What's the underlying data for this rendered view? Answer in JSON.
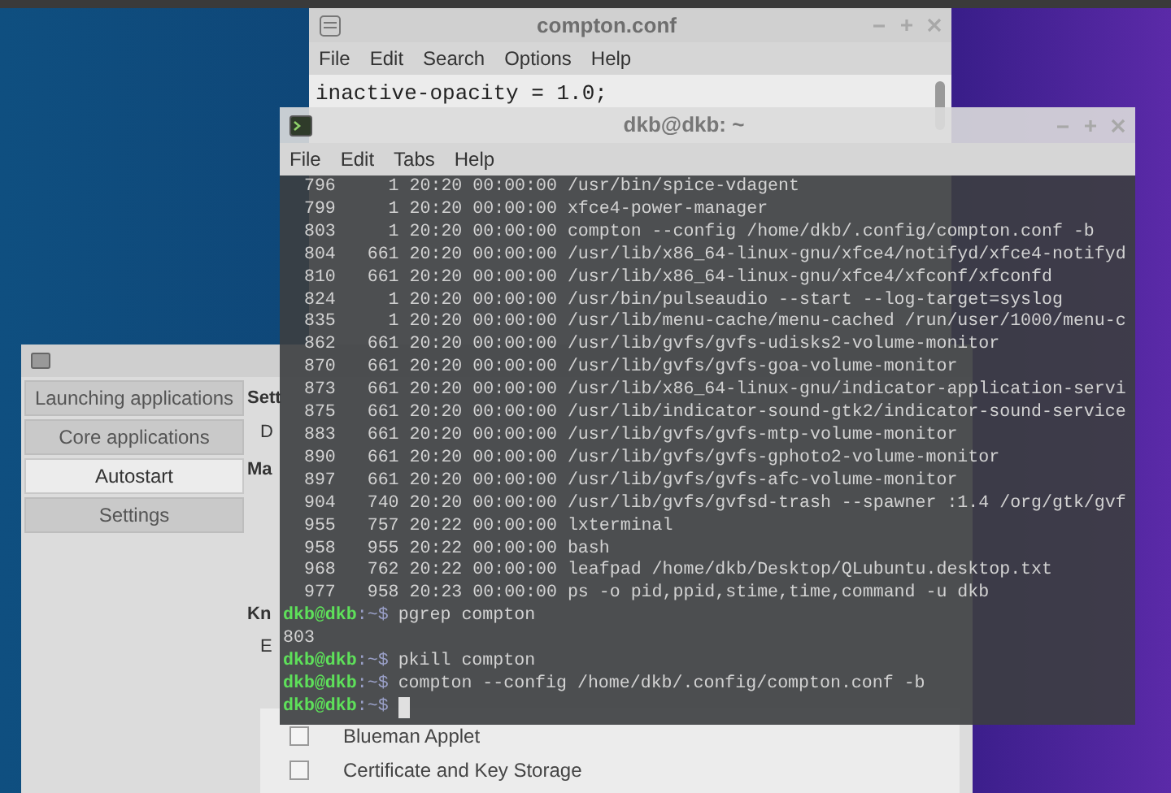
{
  "editor_window": {
    "title": "compton.conf",
    "menu": [
      "File",
      "Edit",
      "Search",
      "Options",
      "Help"
    ],
    "lines": [
      "inactive-opacity = 1.0;"
    ]
  },
  "session_window": {
    "tabs": [
      {
        "label": "Launching applications",
        "selected": false
      },
      {
        "label": "Core applications",
        "selected": false
      },
      {
        "label": "Autostart",
        "selected": true
      },
      {
        "label": "Settings",
        "selected": false
      }
    ],
    "cut_labels": [
      "Sett",
      "D",
      "Ma",
      "Kn",
      "E"
    ],
    "autostart_items": [
      {
        "label": "Blueman Applet",
        "checked": false
      },
      {
        "label": "Certificate and Key Storage",
        "checked": false
      }
    ]
  },
  "terminal_window": {
    "title": "dkb@dkb: ~",
    "menu": [
      "File",
      "Edit",
      "Tabs",
      "Help"
    ],
    "lines": [
      {
        "kind": "output",
        "text": "  796     1 20:20 00:00:00 /usr/bin/spice-vdagent"
      },
      {
        "kind": "output",
        "text": "  799     1 20:20 00:00:00 xfce4-power-manager"
      },
      {
        "kind": "output",
        "text": "  803     1 20:20 00:00:00 compton --config /home/dkb/.config/compton.conf -b"
      },
      {
        "kind": "output",
        "text": "  804   661 20:20 00:00:00 /usr/lib/x86_64-linux-gnu/xfce4/notifyd/xfce4-notifyd"
      },
      {
        "kind": "output",
        "text": "  810   661 20:20 00:00:00 /usr/lib/x86_64-linux-gnu/xfce4/xfconf/xfconfd"
      },
      {
        "kind": "output",
        "text": "  824     1 20:20 00:00:00 /usr/bin/pulseaudio --start --log-target=syslog"
      },
      {
        "kind": "output",
        "text": "  835     1 20:20 00:00:00 /usr/lib/menu-cache/menu-cached /run/user/1000/menu-c"
      },
      {
        "kind": "output",
        "text": "  862   661 20:20 00:00:00 /usr/lib/gvfs/gvfs-udisks2-volume-monitor"
      },
      {
        "kind": "output",
        "text": "  870   661 20:20 00:00:00 /usr/lib/gvfs/gvfs-goa-volume-monitor"
      },
      {
        "kind": "output",
        "text": "  873   661 20:20 00:00:00 /usr/lib/x86_64-linux-gnu/indicator-application-servi"
      },
      {
        "kind": "output",
        "text": "  875   661 20:20 00:00:00 /usr/lib/indicator-sound-gtk2/indicator-sound-service"
      },
      {
        "kind": "output",
        "text": "  883   661 20:20 00:00:00 /usr/lib/gvfs/gvfs-mtp-volume-monitor"
      },
      {
        "kind": "output",
        "text": "  890   661 20:20 00:00:00 /usr/lib/gvfs/gvfs-gphoto2-volume-monitor"
      },
      {
        "kind": "output",
        "text": "  897   661 20:20 00:00:00 /usr/lib/gvfs/gvfs-afc-volume-monitor"
      },
      {
        "kind": "output",
        "text": "  904   740 20:20 00:00:00 /usr/lib/gvfs/gvfsd-trash --spawner :1.4 /org/gtk/gvf"
      },
      {
        "kind": "output",
        "text": "  955   757 20:22 00:00:00 lxterminal"
      },
      {
        "kind": "output",
        "text": "  958   955 20:22 00:00:00 bash"
      },
      {
        "kind": "output",
        "text": "  968   762 20:22 00:00:00 leafpad /home/dkb/Desktop/QLubuntu.desktop.txt"
      },
      {
        "kind": "output",
        "text": "  977   958 20:23 00:00:00 ps -o pid,ppid,stime,time,command -u dkb"
      },
      {
        "kind": "prompt",
        "user": "dkb@dkb",
        "path": ":~$",
        "command": "pgrep compton"
      },
      {
        "kind": "output",
        "text": "803"
      },
      {
        "kind": "prompt",
        "user": "dkb@dkb",
        "path": ":~$",
        "command": "pkill compton"
      },
      {
        "kind": "prompt",
        "user": "dkb@dkb",
        "path": ":~$",
        "command": "compton --config /home/dkb/.config/compton.conf -b"
      },
      {
        "kind": "prompt",
        "user": "dkb@dkb",
        "path": ":~$",
        "cursor": true
      }
    ]
  }
}
